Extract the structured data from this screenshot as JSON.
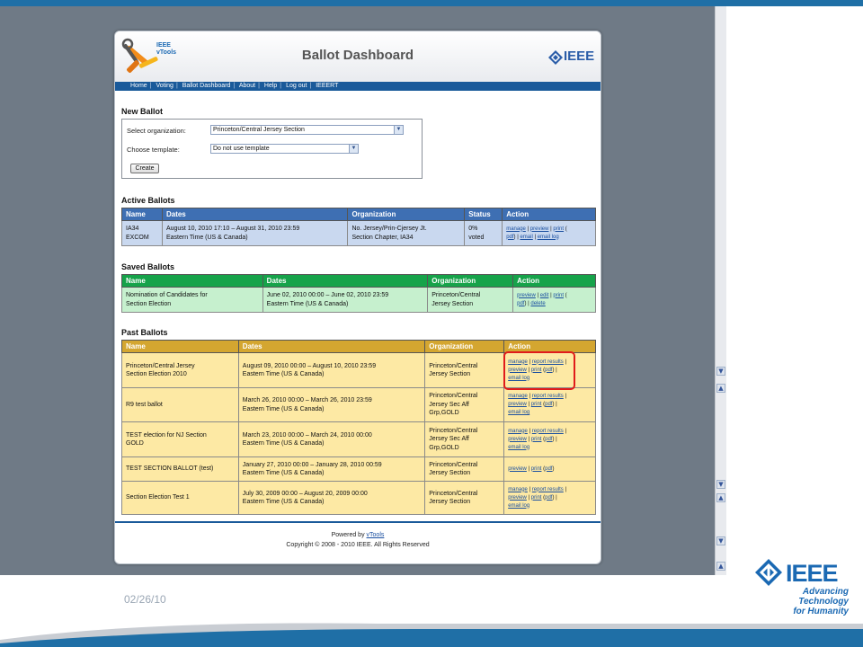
{
  "slide": {
    "date": "02/26/10",
    "brand_word": "IEEE",
    "brand_tagline_1": "Advancing Technology",
    "brand_tagline_2": "for Humanity",
    "accent_color": "#1b69b3"
  },
  "header": {
    "logo_text_1": "IEEE",
    "logo_text_2": "vTools",
    "title": "Ballot Dashboard",
    "brand_word": "IEEE"
  },
  "nav": {
    "items": [
      "Home",
      "Voting",
      "Ballot Dashboard",
      "About",
      "Help",
      "Log out",
      "IEEERT"
    ]
  },
  "new_ballot": {
    "title": "New Ballot",
    "org_label": "Select organization:",
    "org_value": "Princeton/Central Jersey Section",
    "template_label": "Choose template:",
    "template_value": "Do not use template",
    "create_label": "Create"
  },
  "active": {
    "title": "Active Ballots",
    "headers": [
      "Name",
      "Dates",
      "Organization",
      "Status",
      "Action"
    ],
    "rows": [
      {
        "name": [
          "IA34",
          "EXCOM"
        ],
        "dates": [
          "August 10, 2010 17:10 – August 31, 2010 23:59",
          "Eastern Time (US & Canada)"
        ],
        "org": [
          "No. Jersey/Prin-Cjersey Jt.",
          "Section Chapter, IA34"
        ],
        "status": [
          "0%",
          "voted"
        ],
        "actions": {
          "manage": "manage",
          "preview": "preview",
          "print": "print",
          "pdf": "pdf",
          "email": "email",
          "email_log": "email log"
        }
      }
    ]
  },
  "saved": {
    "title": "Saved Ballots",
    "headers": [
      "Name",
      "Dates",
      "Organization",
      "Action"
    ],
    "rows": [
      {
        "name": [
          "Nomination of Candidates for",
          "Section Election"
        ],
        "dates": [
          "June 02, 2010 00:00 – June 02, 2010 23:59",
          "Eastern Time (US & Canada)"
        ],
        "org": [
          "Princeton/Central",
          "Jersey Section"
        ],
        "actions": {
          "preview": "preview",
          "edit": "edit",
          "print": "print",
          "pdf": "pdf",
          "delete": "delete"
        }
      }
    ]
  },
  "past": {
    "title": "Past Ballots",
    "headers": [
      "Name",
      "Dates",
      "Organization",
      "Action"
    ],
    "rows": [
      {
        "name": [
          "Princeton/Central Jersey",
          "Section Election 2010"
        ],
        "dates": [
          "August 09, 2010 00:00 – August 10, 2010 23:59",
          "Eastern Time (US & Canada)"
        ],
        "org": [
          "Princeton/Central",
          "Jersey Section"
        ]
      },
      {
        "name": [
          "R9 test ballot",
          ""
        ],
        "dates": [
          "March 26, 2010 00:00 – March 26, 2010 23:59",
          "Eastern Time (US & Canada)"
        ],
        "org": [
          "Princeton/Central",
          "Jersey Sec Aff",
          "Grp,GOLD"
        ]
      },
      {
        "name": [
          "TEST election for NJ Section",
          "GOLD"
        ],
        "dates": [
          "March 23, 2010 00:00 – March 24, 2010 00:00",
          "Eastern Time (US & Canada)"
        ],
        "org": [
          "Princeton/Central",
          "Jersey Sec Aff",
          "Grp,GOLD"
        ]
      },
      {
        "name": [
          "TEST SECTION BALLOT (test)",
          ""
        ],
        "dates": [
          "January 27, 2010 00:00 – January 28, 2010 00:59",
          "Eastern Time (US & Canada)"
        ],
        "org": [
          "Princeton/Central",
          "Jersey Section"
        ]
      },
      {
        "name": [
          "Section Election Test 1",
          ""
        ],
        "dates": [
          "July 30, 2009 00:00 – August 20, 2009 00:00",
          "Eastern Time (US & Canada)"
        ],
        "org": [
          "Princeton/Central",
          "Jersey Section"
        ]
      }
    ],
    "actions": {
      "manage": "manage",
      "report_results": "report results",
      "preview": "preview",
      "print": "print",
      "pdf": "pdf",
      "email_log": "email log"
    }
  },
  "footer": {
    "powered_by": "Powered by",
    "vtools": "vTools",
    "copyright": "Copyright © 2008 - 2010 IEEE. All Rights Reserved"
  },
  "icons": [
    "tools-logo-icon",
    "ieee-diamond-icon",
    "chevron-down-icon",
    "scroll-arrow-icon"
  ]
}
